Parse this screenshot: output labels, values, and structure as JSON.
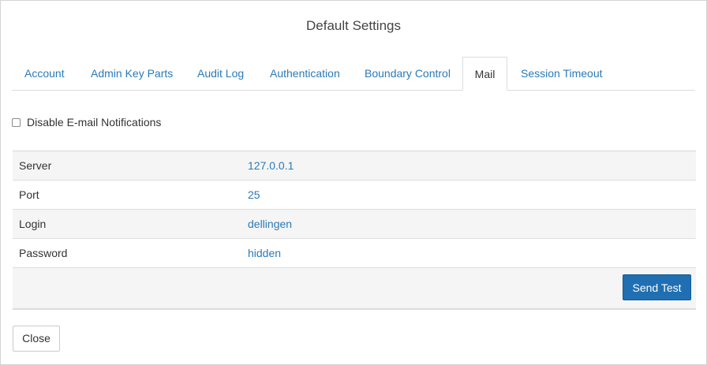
{
  "dialog": {
    "title": "Default Settings"
  },
  "tabs": [
    {
      "label": "Account"
    },
    {
      "label": "Admin Key Parts"
    },
    {
      "label": "Audit Log"
    },
    {
      "label": "Authentication"
    },
    {
      "label": "Boundary Control"
    },
    {
      "label": "Mail",
      "active": true
    },
    {
      "label": "Session Timeout"
    }
  ],
  "mail": {
    "disable_notifications_label": "Disable E-mail Notifications",
    "disable_notifications_checked": false,
    "settings": [
      {
        "key": "Server",
        "value": "127.0.0.1"
      },
      {
        "key": "Port",
        "value": "25"
      },
      {
        "key": "Login",
        "value": "dellingen"
      },
      {
        "key": "Password",
        "value": "hidden"
      }
    ],
    "send_test_label": "Send Test"
  },
  "footer": {
    "close_label": "Close"
  },
  "colors": {
    "link": "#2a7ab8",
    "primary_button": "#1f6fb2"
  }
}
